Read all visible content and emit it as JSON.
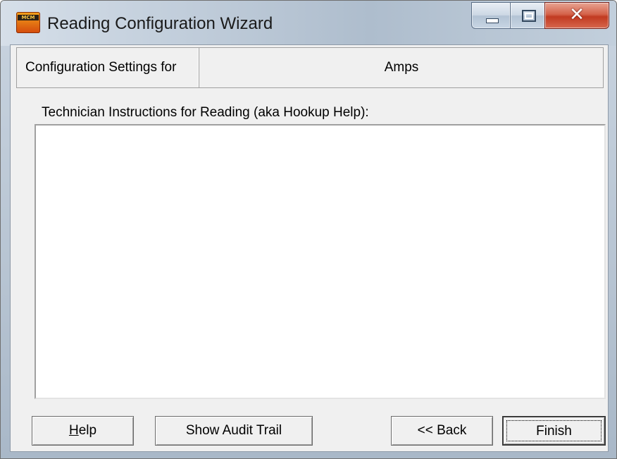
{
  "window": {
    "title": "Reading Configuration Wizard",
    "icon": "app-icon",
    "icon_text": "MCM",
    "close_glyph": "✕"
  },
  "header": {
    "label": "Configuration Settings for",
    "value": "Amps"
  },
  "instructions": {
    "label": "Technician Instructions for Reading (aka Hookup Help):",
    "value": ""
  },
  "buttons": {
    "help_mnemonic": "H",
    "help_rest": "elp",
    "audit": "Show Audit Trail",
    "back": "<< Back",
    "finish": "Finish"
  }
}
